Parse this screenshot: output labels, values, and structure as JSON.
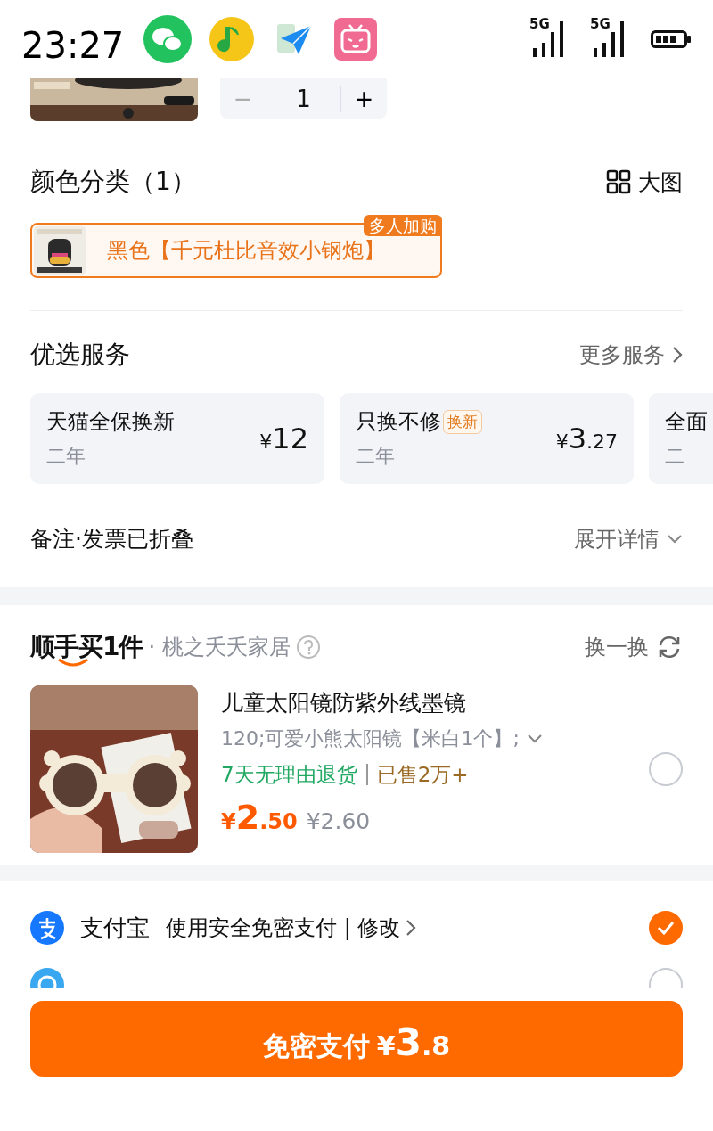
{
  "status_bar": {
    "time": "23:27",
    "network": [
      "5G",
      "5G"
    ]
  },
  "quantity": {
    "value": "1",
    "minus": "−",
    "plus": "+",
    "minus_disabled": true
  },
  "color_section": {
    "title": "颜色分类（1）",
    "view_toggle": "大图",
    "options": [
      {
        "label": "黑色【千元杜比音效小钢炮】",
        "badge": "多人加购",
        "selected": true
      }
    ]
  },
  "services": {
    "title": "优选服务",
    "more": "更多服务",
    "cards": [
      {
        "title": "天猫全保换新",
        "term": "二年",
        "price": {
          "currency": "¥",
          "integer": "12"
        }
      },
      {
        "title": "只换不修",
        "tag": "换新",
        "term": "二年",
        "price": {
          "currency": "¥",
          "integer": "3",
          "decimal": ".27"
        }
      },
      {
        "title": "全面",
        "term": "二"
      }
    ]
  },
  "notes": {
    "label": "备注·发票已折叠",
    "expand": "展开详情"
  },
  "addon": {
    "logo": "顺手买1件",
    "store": "· 桃之夭夭家居",
    "refresh": "换一换",
    "product": {
      "title": "儿童太阳镜防紫外线墨镜",
      "spec": "120;可爱小熊太阳镜【米白1个】;",
      "return_policy": "7天无理由退货",
      "sold": "已售2万+",
      "price": {
        "currency": "¥",
        "integer": "2",
        "decimal": ".50"
      },
      "original_price": "¥2.60",
      "selected": false
    }
  },
  "payment_methods": [
    {
      "name": "支付宝",
      "description": "使用安全免密支付 | 修改",
      "selected": true
    },
    {
      "selected": false
    }
  ],
  "pay_button": {
    "label": "免密支付",
    "price": {
      "currency": "¥",
      "integer": "3",
      "decimal": ".8"
    }
  }
}
